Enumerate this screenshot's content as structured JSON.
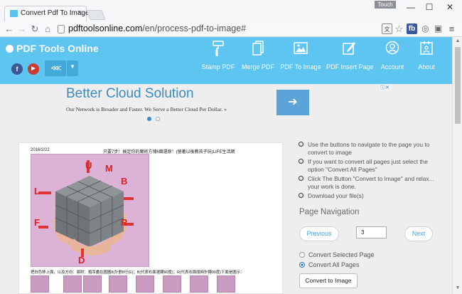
{
  "browser": {
    "tab_title": "Convert Pdf To Image",
    "tab_close": "×",
    "touch_label": "Touch",
    "window_controls": {
      "minimize": "—",
      "maximize": "☐",
      "close": "✕"
    },
    "address": {
      "domain": "pdftoolsonline.com",
      "path": "/en/process-pdf-to-image#"
    },
    "nav_icons": [
      "back-arrow-icon",
      "forward-arrow-icon",
      "reload-icon",
      "home-icon"
    ],
    "extension_icons": [
      "translate-icon",
      "star-icon",
      "fb-extension-icon",
      "compass-icon",
      "tab-icon",
      "menu-icon"
    ]
  },
  "site": {
    "logo": "PDF Tools Online",
    "social": {
      "facebook": "f",
      "youtube": "▶"
    },
    "menu": [
      {
        "label": "Stamp PDF",
        "icon": "paint-roller-icon"
      },
      {
        "label": "Merge PDF",
        "icon": "documents-icon"
      },
      {
        "label": "PDF To Image",
        "icon": "image-icon"
      },
      {
        "label": "PDF Insert Page",
        "icon": "edit-icon"
      },
      {
        "label": "Account",
        "icon": "user-icon"
      },
      {
        "label": "About",
        "icon": "info-icon"
      }
    ]
  },
  "ad": {
    "headline": "Better Cloud Solution",
    "body": "Our Network is Broader and Faster. We Serve a Better Cloud Per Dollar. »",
    "arrow": "➔",
    "adchoices": "ⓘ✕"
  },
  "preview": {
    "date": "2016/2/22",
    "heading": "只要7步！搞定你的魔術方塊6面還原！(留著以後教孩子玩)LIFE生活網",
    "caption": "把白色移上面，以及方向：將附：順序盡在圖圖8(計劃8行(E)；B(代表右面選轉90度)；R(代表右面順時針轉90度)下面是圖示：",
    "cube_letters": {
      "u": "U",
      "m": "M",
      "b": "B",
      "l": "L",
      "f": "F",
      "r": "R",
      "d": "D"
    }
  },
  "instructions": [
    "Use the buttons to navigate to the page you to convert to image",
    "If you want to convert all pages just select the option \"Convert All Pages\"",
    "Click The Button \"Convert to Image\" and relax... your work is done.",
    "Download your file(s)"
  ],
  "page_navigation": {
    "title": "Page Navigation",
    "previous": "Previous",
    "next": "Next",
    "page_value": "3"
  },
  "options": {
    "selected": "Convert Selected Page",
    "all": "Convert All Pages",
    "checked": "all"
  },
  "convert_button": "Convert to Image",
  "colors": {
    "header": "#5ec4f0",
    "accent": "#48a5d5",
    "facebook": "#3b5998",
    "youtube": "#cd3a31"
  }
}
